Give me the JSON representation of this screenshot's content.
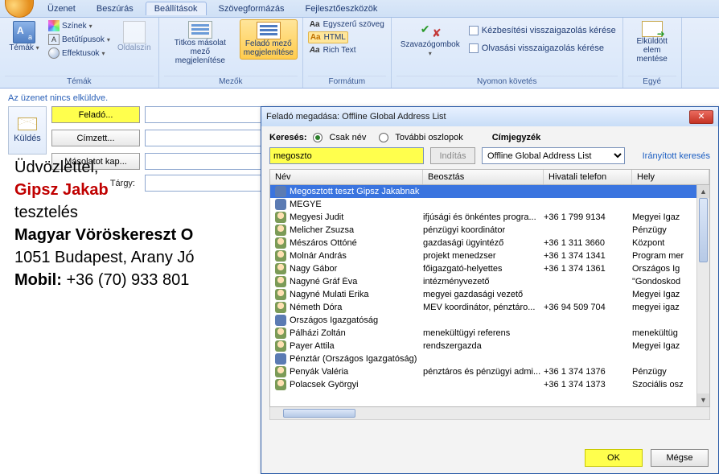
{
  "tabs": [
    "Üzenet",
    "Beszúrás",
    "Beállítások",
    "Szövegformázás",
    "Fejlesztőeszközök"
  ],
  "active_tab": 2,
  "ribbon": {
    "themes": {
      "label": "Témák",
      "big": "Témák",
      "colors": "Színek",
      "fonts": "Betűtípusok",
      "effects": "Effektusok",
      "pagecolor": "Oldalszín"
    },
    "fields": {
      "label": "Mezők",
      "bcc": "Titkos másolat mező megjelenítése",
      "from": "Feladó mező megjelenítése"
    },
    "format": {
      "label": "Formátum",
      "plain": "Egyszerű szöveg",
      "html": "HTML",
      "rich": "Rich Text"
    },
    "track": {
      "label": "Nyomon követés",
      "vote": "Szavazógombok",
      "delivery": "Kézbesítési visszaigazolás kérése",
      "read": "Olvasási visszaigazolás kérése"
    },
    "more": {
      "save": "Elküldött elem mentése"
    }
  },
  "compose": {
    "not_sent": "Az üzenet nincs elküldve.",
    "send": "Küldés",
    "from_btn": "Feladó...",
    "to_btn": "Címzett...",
    "cc_btn": "Másolatot kap...",
    "subject_label": "Tárgy:"
  },
  "body": {
    "greeting": "Üdvözlettel,",
    "name": "Gipsz Jakab",
    "role": "tesztelés",
    "org": "Magyar Vöröskereszt O",
    "addr": "1051 Budapest, Arany Jó",
    "mobil_label": "Mobil: ",
    "mobil_value": "+36 (70) 933 801"
  },
  "dialog": {
    "title": "Feladó megadása: Offline Global Address List",
    "search_label": "Keresés:",
    "only_name": "Csak név",
    "more_cols": "További oszlopok",
    "addrbook_label": "Címjegyzék",
    "search_value": "megoszto",
    "go_btn": "Indítás",
    "book_value": "Offline Global Address List",
    "advanced": "Irányított keresés",
    "headers": {
      "name": "Név",
      "position": "Beosztás",
      "phone": "Hivatali telefon",
      "loc": "Hely"
    },
    "rows": [
      {
        "type": "grp",
        "sel": true,
        "name": "Megosztott teszt Gipsz Jakabnak",
        "pos": "",
        "tel": "",
        "loc": ""
      },
      {
        "type": "grp",
        "sel": false,
        "name": "MEGYE",
        "pos": "",
        "tel": "",
        "loc": ""
      },
      {
        "type": "per",
        "sel": false,
        "name": "Megyesi Judit",
        "pos": "ifjúsági és önkéntes progra...",
        "tel": "+36 1 799 9134",
        "loc": "Megyei Igaz"
      },
      {
        "type": "per",
        "sel": false,
        "name": "Melicher Zsuzsa",
        "pos": "pénzügyi koordinátor",
        "tel": "",
        "loc": "Pénzügy"
      },
      {
        "type": "per",
        "sel": false,
        "name": "Mészáros Ottóné",
        "pos": "gazdasági ügyintéző",
        "tel": "+36 1 311 3660",
        "loc": "Központ"
      },
      {
        "type": "per",
        "sel": false,
        "name": "Molnár András",
        "pos": "projekt menedzser",
        "tel": "+36 1 374 1341",
        "loc": "Program mer"
      },
      {
        "type": "per",
        "sel": false,
        "name": "Nagy Gábor",
        "pos": "főigazgató-helyettes",
        "tel": "+36 1 374 1361",
        "loc": "Országos Ig"
      },
      {
        "type": "per",
        "sel": false,
        "name": "Nagyné Gráf Éva",
        "pos": "intézményvezető",
        "tel": "",
        "loc": "\"Gondoskod"
      },
      {
        "type": "per",
        "sel": false,
        "name": "Nagyné Mulati Erika",
        "pos": "megyei gazdasági vezető",
        "tel": "",
        "loc": "Megyei Igaz"
      },
      {
        "type": "per",
        "sel": false,
        "name": "Németh Dóra",
        "pos": "MEV koordinátor, pénztáro...",
        "tel": "+36  94 509 704",
        "loc": "megyei igaz"
      },
      {
        "type": "grp",
        "sel": false,
        "name": "Országos Igazgatóság",
        "pos": "",
        "tel": "",
        "loc": ""
      },
      {
        "type": "per",
        "sel": false,
        "name": "Pálházi Zoltán",
        "pos": "menekültügyi referens",
        "tel": "",
        "loc": "menekültüg"
      },
      {
        "type": "per",
        "sel": false,
        "name": "Payer Attila",
        "pos": "rendszergazda",
        "tel": "",
        "loc": "Megyei Igaz"
      },
      {
        "type": "grp",
        "sel": false,
        "name": "Pénztár (Országos Igazgatóság)",
        "pos": "",
        "tel": "",
        "loc": ""
      },
      {
        "type": "per",
        "sel": false,
        "name": "Penyák Valéria",
        "pos": "pénztáros és pénzügyi admi...",
        "tel": "+36 1 374 1376",
        "loc": "Pénzügy"
      },
      {
        "type": "per",
        "sel": false,
        "name": "Polacsek Györgyi",
        "pos": "",
        "tel": "+36 1 374 1373",
        "loc": "Szociális osz"
      }
    ],
    "ok": "OK",
    "cancel": "Mégse"
  }
}
